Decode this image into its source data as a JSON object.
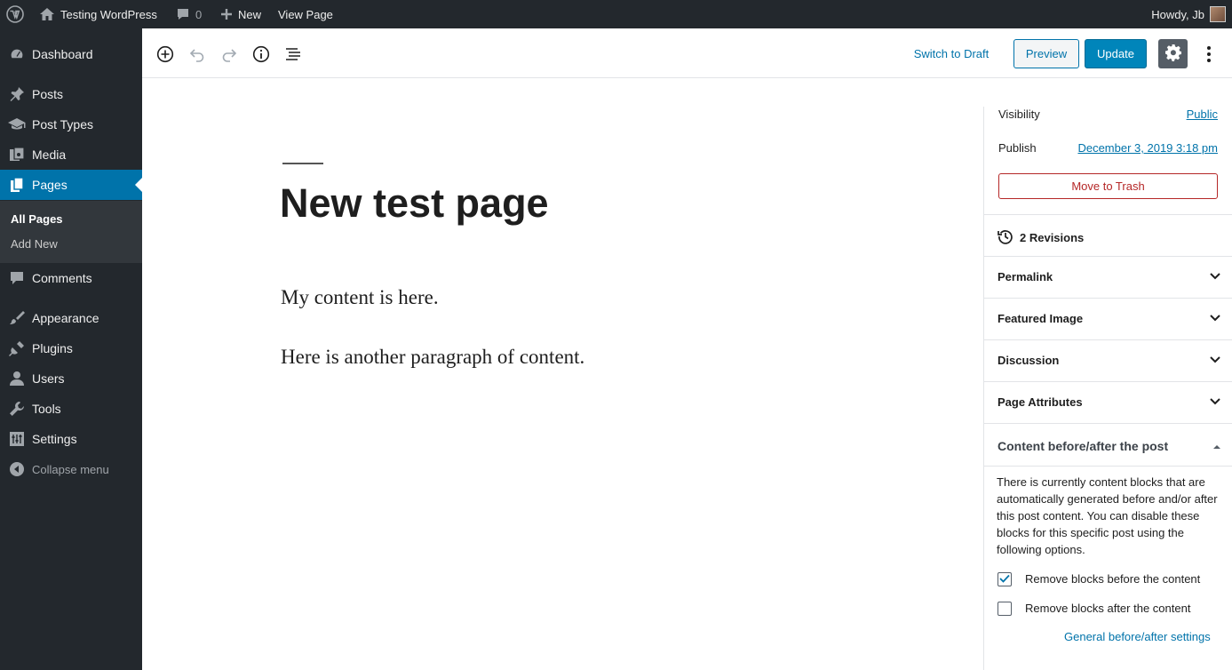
{
  "adminbar": {
    "site_name": "Testing WordPress",
    "comments_count": "0",
    "new_label": "New",
    "view_label": "View Page",
    "howdy": "Howdy, Jb"
  },
  "sidebar": {
    "items": [
      {
        "label": "Dashboard",
        "icon": "dashboard-icon"
      },
      {
        "label": "Posts",
        "icon": "pin-icon"
      },
      {
        "label": "Post Types",
        "icon": "graduation-cap-icon"
      },
      {
        "label": "Media",
        "icon": "media-icon"
      },
      {
        "label": "Pages",
        "icon": "pages-icon"
      },
      {
        "label": "Comments",
        "icon": "comment-icon"
      },
      {
        "label": "Appearance",
        "icon": "brush-icon"
      },
      {
        "label": "Plugins",
        "icon": "plug-icon"
      },
      {
        "label": "Users",
        "icon": "user-icon"
      },
      {
        "label": "Tools",
        "icon": "wrench-icon"
      },
      {
        "label": "Settings",
        "icon": "settings-icon"
      },
      {
        "label": "Collapse menu",
        "icon": "collapse-icon"
      }
    ],
    "submenu": [
      "All Pages",
      "Add New"
    ]
  },
  "toolbar": {
    "switch_draft": "Switch to Draft",
    "preview": "Preview",
    "update": "Update"
  },
  "editor": {
    "title": "New test page",
    "paragraphs": [
      "My content is here.",
      "Here is another paragraph of content."
    ]
  },
  "panel": {
    "visibility_label": "Visibility",
    "visibility_value": "Public",
    "publish_label": "Publish",
    "publish_value": "December 3, 2019 3:18 pm",
    "trash": "Move to Trash",
    "revisions": "2 Revisions",
    "sections": [
      "Permalink",
      "Featured Image",
      "Discussion",
      "Page Attributes"
    ],
    "content_section": "Content before/after the post",
    "description": "There is currently content blocks that are automatically generated before and/or after this post content. You can disable these blocks for this specific post using the following options.",
    "checkbox_before": "Remove blocks before the content",
    "checkbox_before_checked": true,
    "checkbox_after": "Remove blocks after the content",
    "checkbox_after_checked": false,
    "settings_link": "General before/after settings"
  },
  "colors": {
    "admin_dark": "#23282d",
    "accent": "#0073aa",
    "danger": "#b52727"
  }
}
